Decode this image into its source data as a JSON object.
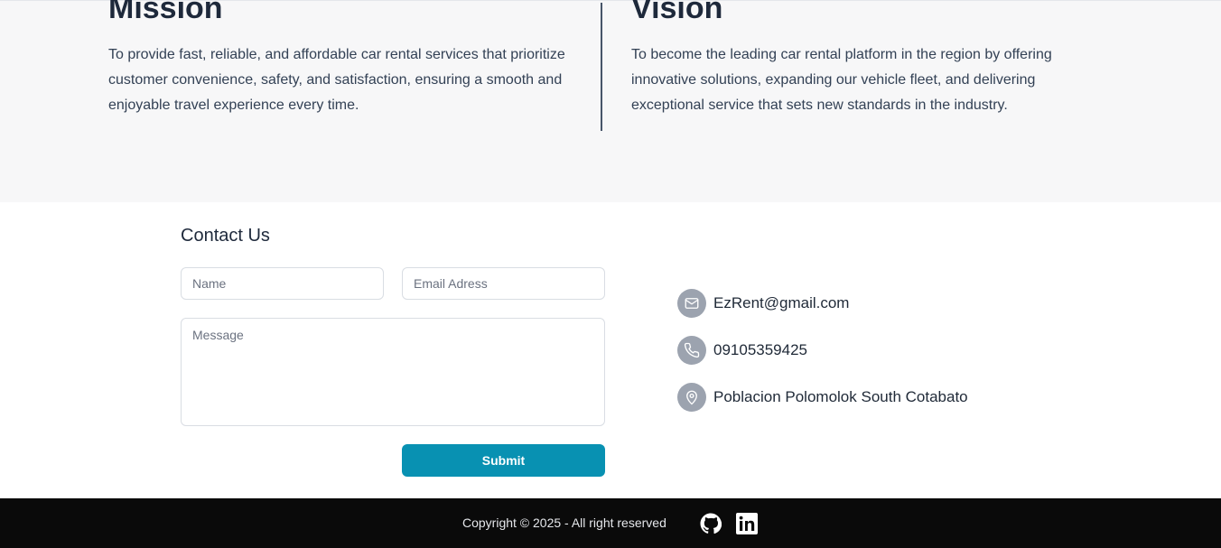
{
  "mission": {
    "title": "Mission",
    "text": "To provide fast, reliable, and affordable car rental services that prioritize customer convenience, safety, and satisfaction, ensuring a smooth and enjoyable travel experience every time."
  },
  "vision": {
    "title": "Vision",
    "text": "To become the leading car rental platform in the region by offering innovative solutions, expanding our vehicle fleet, and delivering exceptional service that sets new standards in the industry."
  },
  "contact": {
    "title": "Contact Us",
    "name_placeholder": "Name",
    "email_placeholder": "Email Adress",
    "message_placeholder": "Message",
    "submit_label": "Submit"
  },
  "info": {
    "email": "EzRent@gmail.com",
    "phone": "09105359425",
    "location": "Poblacion Polomolok South Cotabato",
    "email_icon": "mail-icon",
    "phone_icon": "phone-icon",
    "location_icon": "map-pin-icon"
  },
  "footer": {
    "copyright": "Copyright © 2025 - All right reserved",
    "github_icon": "github-icon",
    "linkedin_icon": "linkedin-icon"
  },
  "colors": {
    "accent": "#0891b2",
    "footer_bg": "#0a0a0a",
    "section_bg": "#f7f7f8",
    "icon_bg": "#9ca3af"
  }
}
